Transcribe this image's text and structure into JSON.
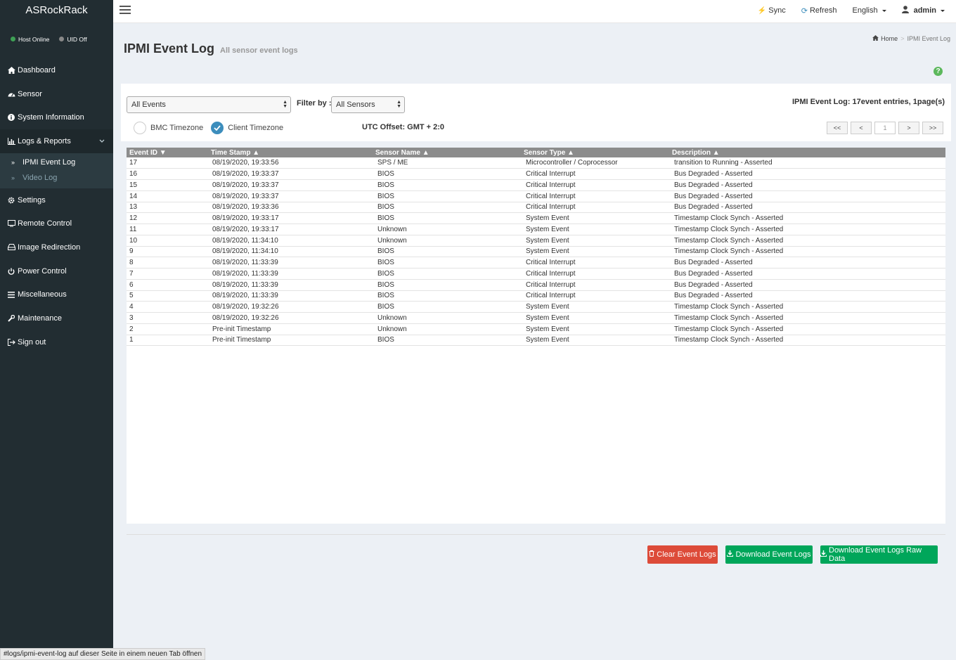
{
  "brand": "ASRockRack",
  "status": {
    "host": "Host Online",
    "uid": "UID Off",
    "host_color": "#3ea055",
    "uid_color": "#888888"
  },
  "sidebar": {
    "items": [
      {
        "label": "Dashboard",
        "icon": "home-icon"
      },
      {
        "label": "Sensor",
        "icon": "dashboard-icon"
      },
      {
        "label": "System Information",
        "icon": "info-icon"
      },
      {
        "label": "Logs & Reports",
        "icon": "bar-chart-icon"
      },
      {
        "label": "Settings",
        "icon": "gear-icon"
      },
      {
        "label": "Remote Control",
        "icon": "monitor-icon"
      },
      {
        "label": "Image Redirection",
        "icon": "hdd-icon"
      },
      {
        "label": "Power Control",
        "icon": "power-icon"
      },
      {
        "label": "Miscellaneous",
        "icon": "list-icon"
      },
      {
        "label": "Maintenance",
        "icon": "wrench-icon"
      },
      {
        "label": "Sign out",
        "icon": "sign-out-icon"
      }
    ],
    "sub_items": [
      {
        "label": "IPMI Event Log"
      },
      {
        "label": "Video Log"
      }
    ]
  },
  "topbar": {
    "sync": "Sync",
    "refresh": "Refresh",
    "language": "English",
    "user": "admin"
  },
  "page": {
    "title": "IPMI Event Log",
    "subtitle": "All sensor event logs"
  },
  "breadcrumb": {
    "home": "Home",
    "current": "IPMI Event Log"
  },
  "filters": {
    "event_select": "All Events",
    "filter_label": "Filter by :",
    "sensor_select": "All Sensors",
    "summary": "IPMI Event Log: 17event entries, 1page(s)",
    "bmc_timezone": "BMC Timezone",
    "client_timezone": "Client Timezone",
    "utc_offset": "UTC Offset: GMT + 2:0"
  },
  "pager": {
    "first": "<<",
    "prev": "<",
    "page": "1",
    "next": ">",
    "last": ">>"
  },
  "table": {
    "headers": [
      "Event ID ▼",
      "Time Stamp ▲",
      "Sensor Name ▲",
      "Sensor Type ▲",
      "Description ▲"
    ],
    "rows": [
      [
        "17",
        "08/19/2020, 19:33:56",
        "SPS / ME",
        "Microcontroller / Coprocessor",
        "transition to Running - Asserted"
      ],
      [
        "16",
        "08/19/2020, 19:33:37",
        "BIOS",
        "Critical Interrupt",
        "Bus Degraded - Asserted"
      ],
      [
        "15",
        "08/19/2020, 19:33:37",
        "BIOS",
        "Critical Interrupt",
        "Bus Degraded - Asserted"
      ],
      [
        "14",
        "08/19/2020, 19:33:37",
        "BIOS",
        "Critical Interrupt",
        "Bus Degraded - Asserted"
      ],
      [
        "13",
        "08/19/2020, 19:33:36",
        "BIOS",
        "Critical Interrupt",
        "Bus Degraded - Asserted"
      ],
      [
        "12",
        "08/19/2020, 19:33:17",
        "BIOS",
        "System Event",
        "Timestamp Clock Synch - Asserted"
      ],
      [
        "11",
        "08/19/2020, 19:33:17",
        "Unknown",
        "System Event",
        "Timestamp Clock Synch - Asserted"
      ],
      [
        "10",
        "08/19/2020, 11:34:10",
        "Unknown",
        "System Event",
        "Timestamp Clock Synch - Asserted"
      ],
      [
        "9",
        "08/19/2020, 11:34:10",
        "BIOS",
        "System Event",
        "Timestamp Clock Synch - Asserted"
      ],
      [
        "8",
        "08/19/2020, 11:33:39",
        "BIOS",
        "Critical Interrupt",
        "Bus Degraded - Asserted"
      ],
      [
        "7",
        "08/19/2020, 11:33:39",
        "BIOS",
        "Critical Interrupt",
        "Bus Degraded - Asserted"
      ],
      [
        "6",
        "08/19/2020, 11:33:39",
        "BIOS",
        "Critical Interrupt",
        "Bus Degraded - Asserted"
      ],
      [
        "5",
        "08/19/2020, 11:33:39",
        "BIOS",
        "Critical Interrupt",
        "Bus Degraded - Asserted"
      ],
      [
        "4",
        "08/19/2020, 19:32:26",
        "BIOS",
        "System Event",
        "Timestamp Clock Synch - Asserted"
      ],
      [
        "3",
        "08/19/2020, 19:32:26",
        "Unknown",
        "System Event",
        "Timestamp Clock Synch - Asserted"
      ],
      [
        "2",
        "Pre-init Timestamp",
        "Unknown",
        "System Event",
        "Timestamp Clock Synch - Asserted"
      ],
      [
        "1",
        "Pre-init Timestamp",
        "BIOS",
        "System Event",
        "Timestamp Clock Synch - Asserted"
      ]
    ]
  },
  "buttons": {
    "clear": "Clear Event Logs",
    "download": "Download Event Logs",
    "download_raw": "Download Event Logs Raw Data"
  },
  "colors": {
    "clear": "#dd4b39",
    "download": "#00a65a",
    "sidebar": "#222d32",
    "accent": "#3c8dbc"
  },
  "statusbar": "#logs/ipmi-event-log auf dieser Seite in einem neuen Tab öffnen"
}
